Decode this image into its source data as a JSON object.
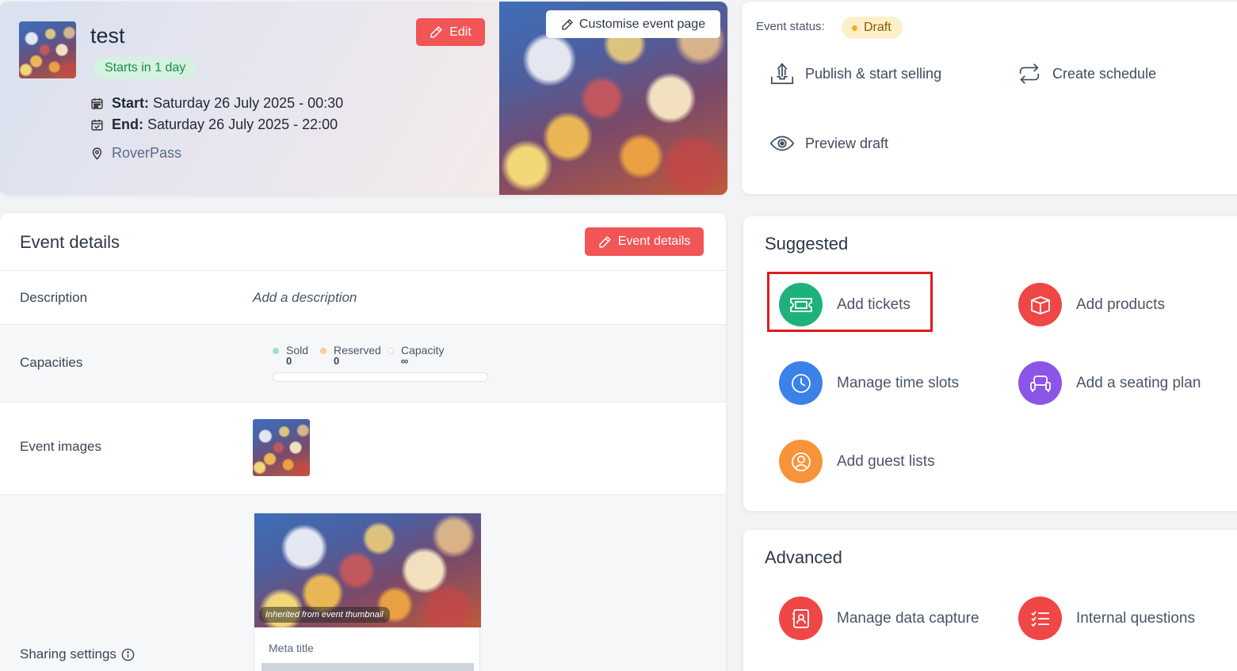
{
  "event": {
    "title": "test",
    "starts_badge": "Starts in 1 day",
    "start_label": "Start:",
    "start_value": "Saturday 26 July 2025 - 00:30",
    "end_label": "End:",
    "end_value": "Saturday 26 July 2025 - 22:00",
    "venue": "RoverPass",
    "edit_label": "Edit",
    "customise_label": "Customise event page"
  },
  "status": {
    "label": "Event status:",
    "badge": "Draft",
    "actions": {
      "publish": "Publish & start selling",
      "schedule": "Create schedule",
      "preview": "Preview draft"
    }
  },
  "details": {
    "title": "Event details",
    "button": "Event details",
    "description_label": "Description",
    "description_placeholder": "Add a description",
    "capacities_label": "Capacities",
    "capacities": {
      "sold_label": "Sold",
      "sold_value": "0",
      "reserved_label": "Reserved",
      "reserved_value": "0",
      "capacity_label": "Capacity",
      "capacity_value": "∞"
    },
    "images_label": "Event images",
    "sharing_label": "Sharing settings",
    "inherited_caption": "Inherited from event thumbnail",
    "meta_title_label": "Meta title"
  },
  "suggested": {
    "title": "Suggested",
    "items": {
      "tickets": "Add tickets",
      "products": "Add products",
      "timeslots": "Manage time slots",
      "seating": "Add a seating plan",
      "guests": "Add guest lists"
    }
  },
  "advanced": {
    "title": "Advanced",
    "items": {
      "datacapture": "Manage data capture",
      "questions": "Internal questions"
    }
  },
  "colors": {
    "brand_red": "#f25555",
    "tickets_green": "#1eb27a",
    "products_red": "#ef4646",
    "timeslots_blue": "#3b82e8",
    "seating_purple": "#8b55e8",
    "guests_orange": "#f7943b",
    "sold_dot": "#9ee3b5",
    "reserved_dot": "#fbc99a"
  },
  "icons": [
    "calendar-icon",
    "calendar-check-icon",
    "location-pin-icon",
    "pencil-icon",
    "upload-icon",
    "repeat-icon",
    "eye-icon",
    "ticket-icon",
    "box-icon",
    "clock-icon",
    "sofa-icon",
    "user-circle-icon",
    "contact-card-icon",
    "checklist-icon",
    "info-icon"
  ]
}
